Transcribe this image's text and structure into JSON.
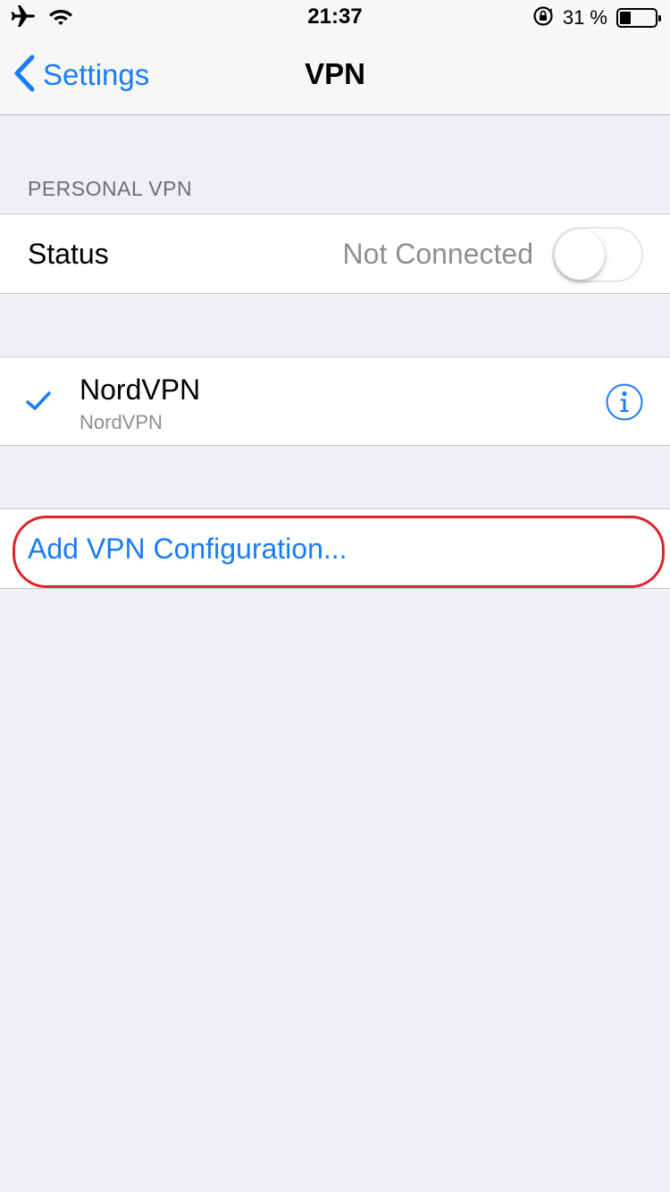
{
  "status_bar": {
    "time": "21:37",
    "battery_percent": "31 %",
    "battery_level": 0.31,
    "icons": [
      "airplane-icon",
      "wifi-icon",
      "orientation-lock-icon",
      "battery-icon"
    ]
  },
  "nav": {
    "back_label": "Settings",
    "title": "VPN"
  },
  "personal_vpn": {
    "header": "PERSONAL VPN",
    "status_label": "Status",
    "status_value": "Not Connected",
    "toggle_on": false
  },
  "vpn_list": [
    {
      "name": "NordVPN",
      "type": "NordVPN",
      "selected": true
    }
  ],
  "add_configuration": {
    "label": "Add VPN Configuration..."
  },
  "colors": {
    "accent": "#1a7cf5",
    "highlight_ring": "#e0242c",
    "background": "#efeff4"
  }
}
